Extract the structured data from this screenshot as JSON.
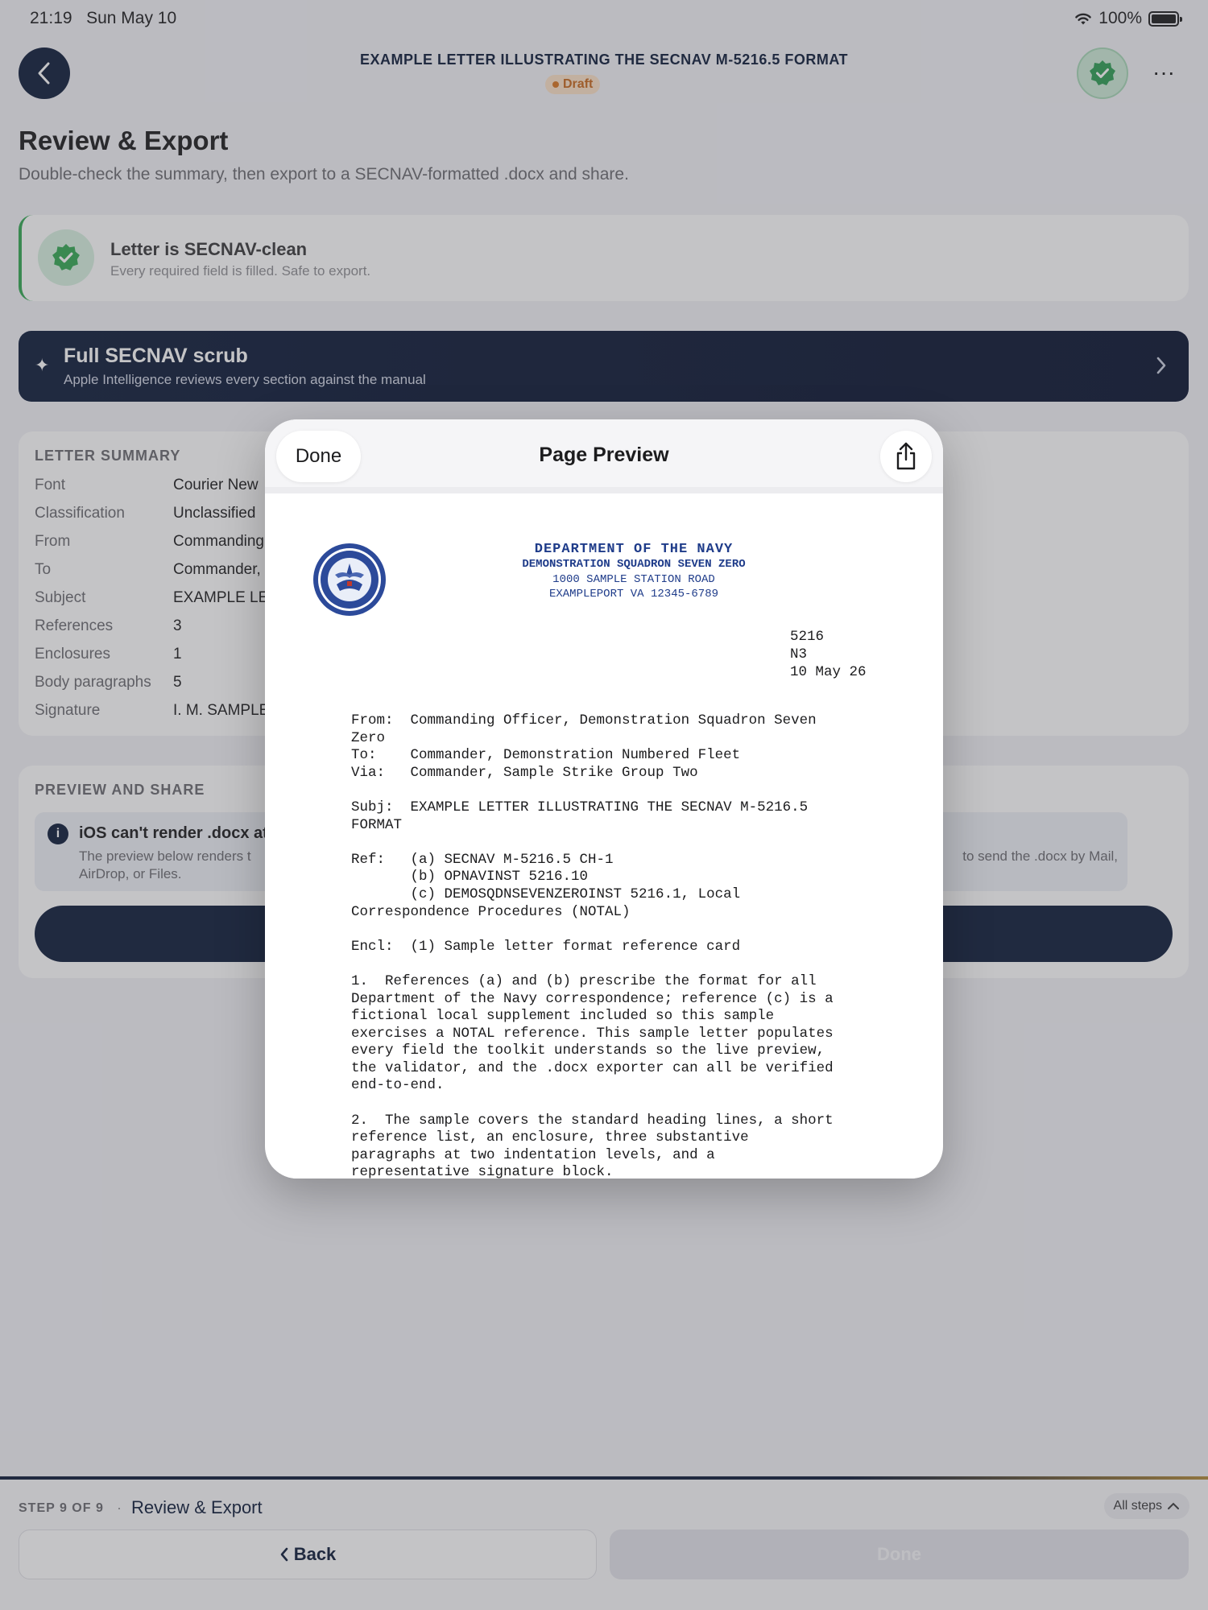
{
  "status_bar": {
    "time": "21:19",
    "date": "Sun May 10",
    "battery": "100%"
  },
  "nav": {
    "title": "EXAMPLE LETTER ILLUSTRATING THE SECNAV M-5216.5 FORMAT",
    "badge": "Draft",
    "more": "···"
  },
  "page": {
    "title": "Review & Export",
    "subtitle": "Double-check the summary, then export to a SECNAV-formatted .docx and share."
  },
  "clean_card": {
    "title": "Letter is SECNAV-clean",
    "subtitle": "Every required field is filled. Safe to export."
  },
  "scrub_card": {
    "title": "Full SECNAV scrub",
    "subtitle": "Apple Intelligence reviews every section against the manual"
  },
  "summary": {
    "heading": "LETTER SUMMARY",
    "rows": [
      {
        "k": "Font",
        "v": "Courier New"
      },
      {
        "k": "Classification",
        "v": "Unclassified"
      },
      {
        "k": "From",
        "v": "Commanding"
      },
      {
        "k": "To",
        "v": "Commander,"
      },
      {
        "k": "Subject",
        "v": "EXAMPLE LE"
      },
      {
        "k": "References",
        "v": "3"
      },
      {
        "k": "Enclosures",
        "v": "1"
      },
      {
        "k": "Body paragraphs",
        "v": "5"
      },
      {
        "k": "Signature",
        "v": "I. M. SAMPLE"
      }
    ]
  },
  "share": {
    "heading": "PREVIEW AND SHARE",
    "info_title": "iOS can't render .docx at",
    "info_text_left": "The preview below renders t",
    "info_text_right": "to send the .docx by Mail,",
    "info_text_line2": "AirDrop, or Files."
  },
  "bottom": {
    "step": "STEP 9 OF 9",
    "dot": "·",
    "title": "Review & Export",
    "all_steps": "All steps",
    "back": "Back",
    "done": "Done"
  },
  "modal": {
    "done": "Done",
    "title": "Page Preview"
  },
  "letter": {
    "line1": "DEPARTMENT OF THE NAVY",
    "line2": "DEMONSTRATION SQUADRON SEVEN ZERO",
    "line3": "1000 SAMPLE STATION ROAD",
    "line4": "EXAMPLEPORT VA 12345-6789",
    "ssic": "5216\nN3\n10 May 26",
    "body": "From:  Commanding Officer, Demonstration Squadron Seven\nZero\nTo:    Commander, Demonstration Numbered Fleet\nVia:   Commander, Sample Strike Group Two\n\nSubj:  EXAMPLE LETTER ILLUSTRATING THE SECNAV M-5216.5\nFORMAT\n\nRef:   (a) SECNAV M-5216.5 CH-1\n       (b) OPNAVINST 5216.10\n       (c) DEMOSQDNSEVENZEROINST 5216.1, Local\nCorrespondence Procedures (NOTAL)\n\nEncl:  (1) Sample letter format reference card\n\n1.  References (a) and (b) prescribe the format for all\nDepartment of the Navy correspondence; reference (c) is a\nfictional local supplement included so this sample\nexercises a NOTAL reference. This sample letter populates\nevery field the toolkit understands so the live preview,\nthe validator, and the .docx exporter can all be verified\nend-to-end.\n\n2.  The sample covers the standard heading lines, a short\nreference list, an enclosure, three substantive\nparagraphs at two indentation levels, and a\nrepresentative signature block."
  },
  "colors": {
    "navy": "#0e1c3a",
    "success": "#34a853",
    "draft": "#d97520",
    "letterhead": "#1f3c8a"
  }
}
